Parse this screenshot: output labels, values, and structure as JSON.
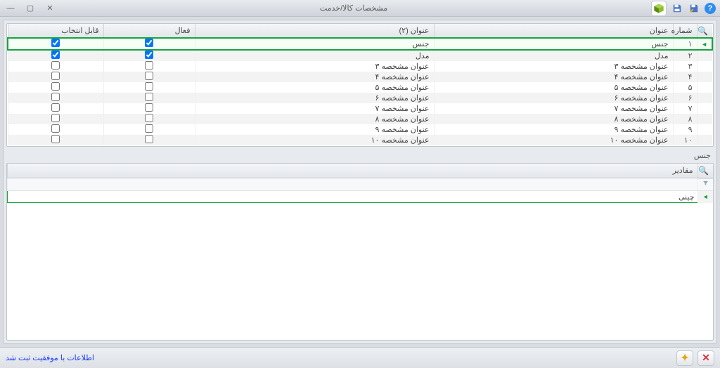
{
  "window": {
    "title": "مشخصات کالا/خدمت"
  },
  "top_grid": {
    "headers": {
      "number": "شماره",
      "title1": "عنوان",
      "title2": "عنوان (۲)",
      "active": "فعال",
      "selectable": "قابل انتخاب"
    },
    "rows": [
      {
        "num": "۱",
        "title1": "جنس",
        "title2": "جنس",
        "active": true,
        "selectable": true
      },
      {
        "num": "۲",
        "title1": "مدل",
        "title2": "مدل",
        "active": true,
        "selectable": true
      },
      {
        "num": "۳",
        "title1": "عنوان مشخصه ۳",
        "title2": "عنوان مشخصه ۳",
        "active": false,
        "selectable": false
      },
      {
        "num": "۴",
        "title1": "عنوان مشخصه ۴",
        "title2": "عنوان مشخصه ۴",
        "active": false,
        "selectable": false
      },
      {
        "num": "۵",
        "title1": "عنوان مشخصه ۵",
        "title2": "عنوان مشخصه ۵",
        "active": false,
        "selectable": false
      },
      {
        "num": "۶",
        "title1": "عنوان مشخصه ۶",
        "title2": "عنوان مشخصه ۶",
        "active": false,
        "selectable": false
      },
      {
        "num": "۷",
        "title1": "عنوان مشخصه ۷",
        "title2": "عنوان مشخصه ۷",
        "active": false,
        "selectable": false
      },
      {
        "num": "۸",
        "title1": "عنوان مشخصه ۸",
        "title2": "عنوان مشخصه ۸",
        "active": false,
        "selectable": false
      },
      {
        "num": "۹",
        "title1": "عنوان مشخصه ۹",
        "title2": "عنوان مشخصه ۹",
        "active": false,
        "selectable": false
      },
      {
        "num": "۱۰",
        "title1": "عنوان مشخصه ۱۰",
        "title2": "عنوان مشخصه ۱۰",
        "active": false,
        "selectable": false
      }
    ]
  },
  "mid_label": "جنس",
  "bottom_grid": {
    "header": "مقادیر",
    "selected_value": "چینی"
  },
  "footer": {
    "status": "اطلاعات با موفقیت ثبت شد"
  }
}
